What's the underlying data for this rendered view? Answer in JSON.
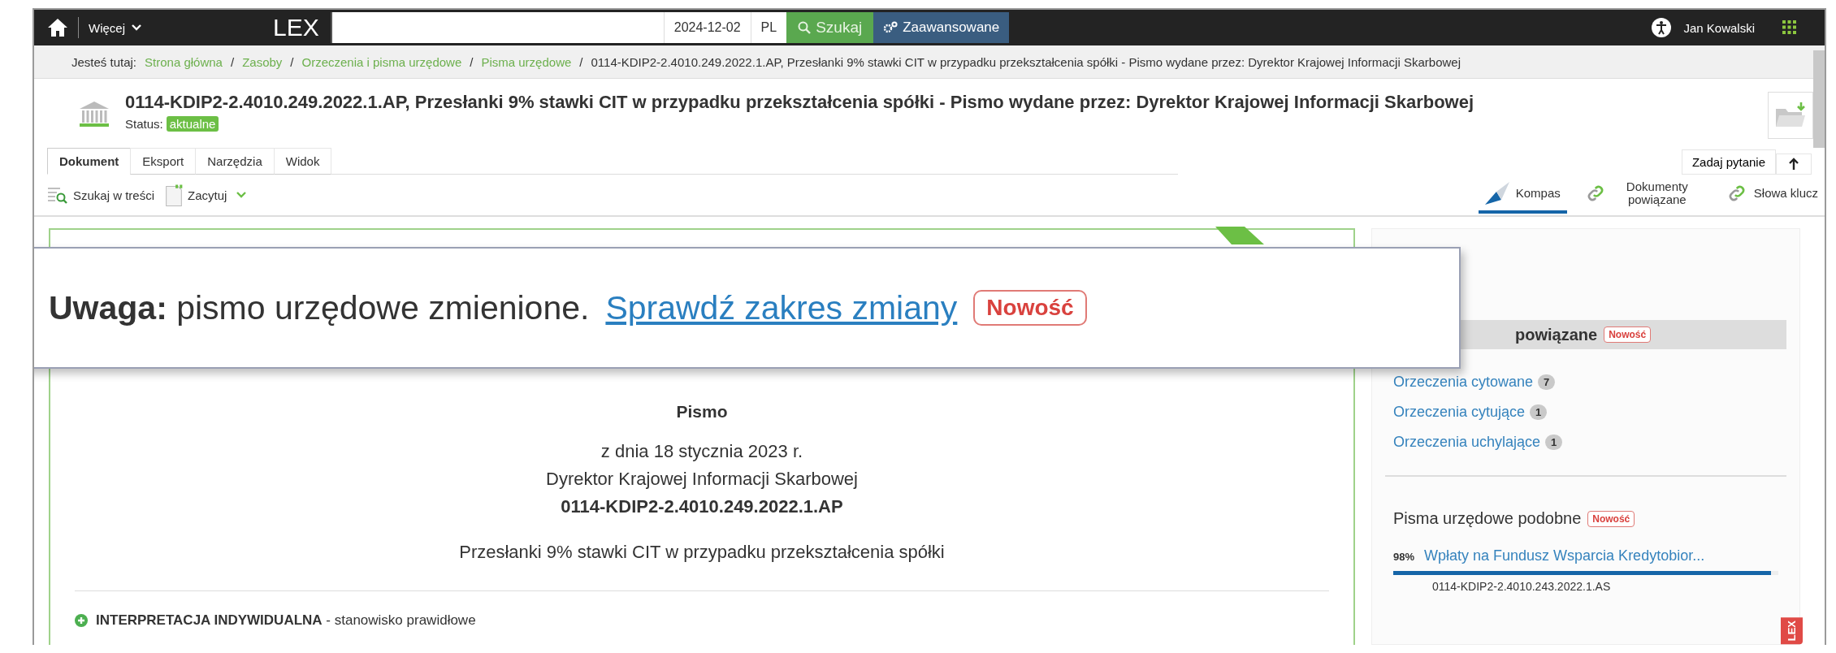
{
  "topbar": {
    "more": "Więcej",
    "logo": "LEX",
    "date": "2024-12-02",
    "lang": "PL",
    "search_button": "Szukaj",
    "advanced_button": "Zaawansowane",
    "user": "Jan Kowalski"
  },
  "breadcrumb": {
    "label": "Jesteś tutaj:",
    "items": [
      "Strona główna",
      "Zasoby",
      "Orzeczenia i pisma urzędowe",
      "Pisma urzędowe"
    ],
    "separator": "/",
    "current": "0114-KDIP2-2.4010.249.2022.1.AP, Przesłanki 9% stawki CIT w przypadku przekształcenia spółki - Pismo wydane przez: Dyrektor Krajowej Informacji Skarbowej"
  },
  "document": {
    "title": "0114-KDIP2-2.4010.249.2022.1.AP, Przesłanki 9% stawki CIT w przypadku przekształcenia spółki - Pismo wydane przez: Dyrektor Krajowej Informacji Skarbowej",
    "status_label": "Status:",
    "status": "aktualne"
  },
  "tabs": [
    {
      "label": "Dokument",
      "selected": true
    },
    {
      "label": "Eksport",
      "selected": false
    },
    {
      "label": "Narzędzia",
      "selected": false
    },
    {
      "label": "Widok",
      "selected": false
    }
  ],
  "toolbar": [
    {
      "kind": "search",
      "label": "Szukaj w treści"
    },
    {
      "kind": "quote",
      "label": "Zacytuj"
    }
  ],
  "ask_button": "Zadaj pytanie",
  "side_tabs": [
    {
      "kind": "compass",
      "label": "Kompas",
      "selected": true
    },
    {
      "kind": "link",
      "label": "Dokumenty powiązane",
      "selected": false
    },
    {
      "kind": "link",
      "label": "Słowa klucz",
      "selected": false
    }
  ],
  "callout": {
    "text": "**Uwaga:** pismo urzędowe zmienione.",
    "link": "Sprawdź zakres zmiany",
    "badge": "Nowość"
  },
  "letter": {
    "heading": "Pismo",
    "date": "z dnia 18 stycznia 2023 r.",
    "issuer": "Dyrektor Krajowej Informacji Skarbowej",
    "signature": "0114-KDIP2-2.4010.249.2022.1.AP",
    "subject": "Przesłanki 9% stawki CIT w przypadku przekształcenia spółki"
  },
  "interpretation": {
    "title": "INTERPRETACJA INDYWIDUALNA",
    "text": "- stanowisko prawidłowe"
  },
  "related": {
    "title": "powiązane",
    "badge": "Nowość",
    "items": [
      {
        "label": "Orzeczenia cytowane",
        "count": "7"
      },
      {
        "label": "Orzeczenia cytujące",
        "count": "1"
      },
      {
        "label": "Orzeczenia uchylające",
        "count": "1"
      }
    ]
  },
  "similar": {
    "title": "Pisma urzędowe podobne",
    "badge": "Nowość",
    "items": [
      {
        "score": "98%",
        "title": "Wpłaty na Fundusz Wsparcia Kredytobior...",
        "level": 0.98,
        "id": "0114-KDIP2-2.4010.243.2022.1.AS"
      }
    ]
  },
  "side_badge": "LEX"
}
